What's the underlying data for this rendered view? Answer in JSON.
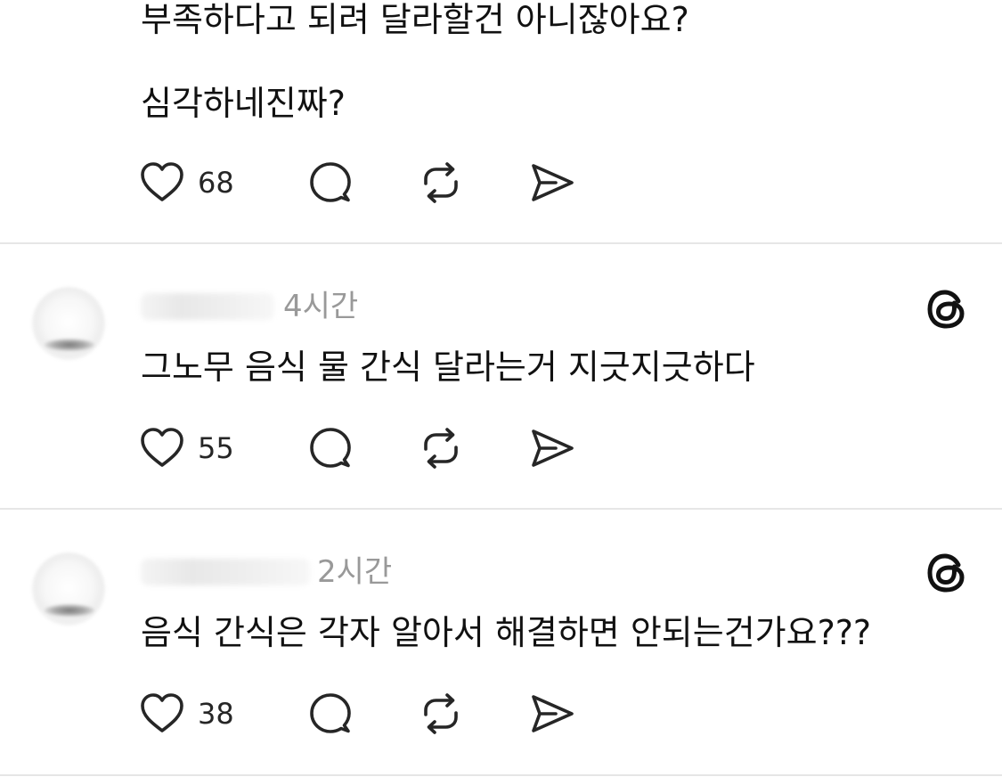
{
  "posts": [
    {
      "lines": [
        "부족하다고 되려 달라할건 아니잖아요?",
        "심각하네진짜?"
      ],
      "likes": "68"
    },
    {
      "time": "4시간",
      "text": "그노무 음식 물 간식  달라는거 지긋지긋하다",
      "likes": "55"
    },
    {
      "time": "2시간",
      "text": "음식 간식은 각자 알아서 해결하면 안되는건가요???",
      "likes": "38"
    }
  ],
  "icons": {
    "like": "heart-icon",
    "reply": "comment-bubble-icon",
    "repost": "repost-icon",
    "share": "send-icon",
    "brand": "threads-logo-icon"
  },
  "colors": {
    "text": "#111111",
    "secondary": "#999999",
    "divider": "#e6e6e6",
    "icon": "#262626"
  }
}
